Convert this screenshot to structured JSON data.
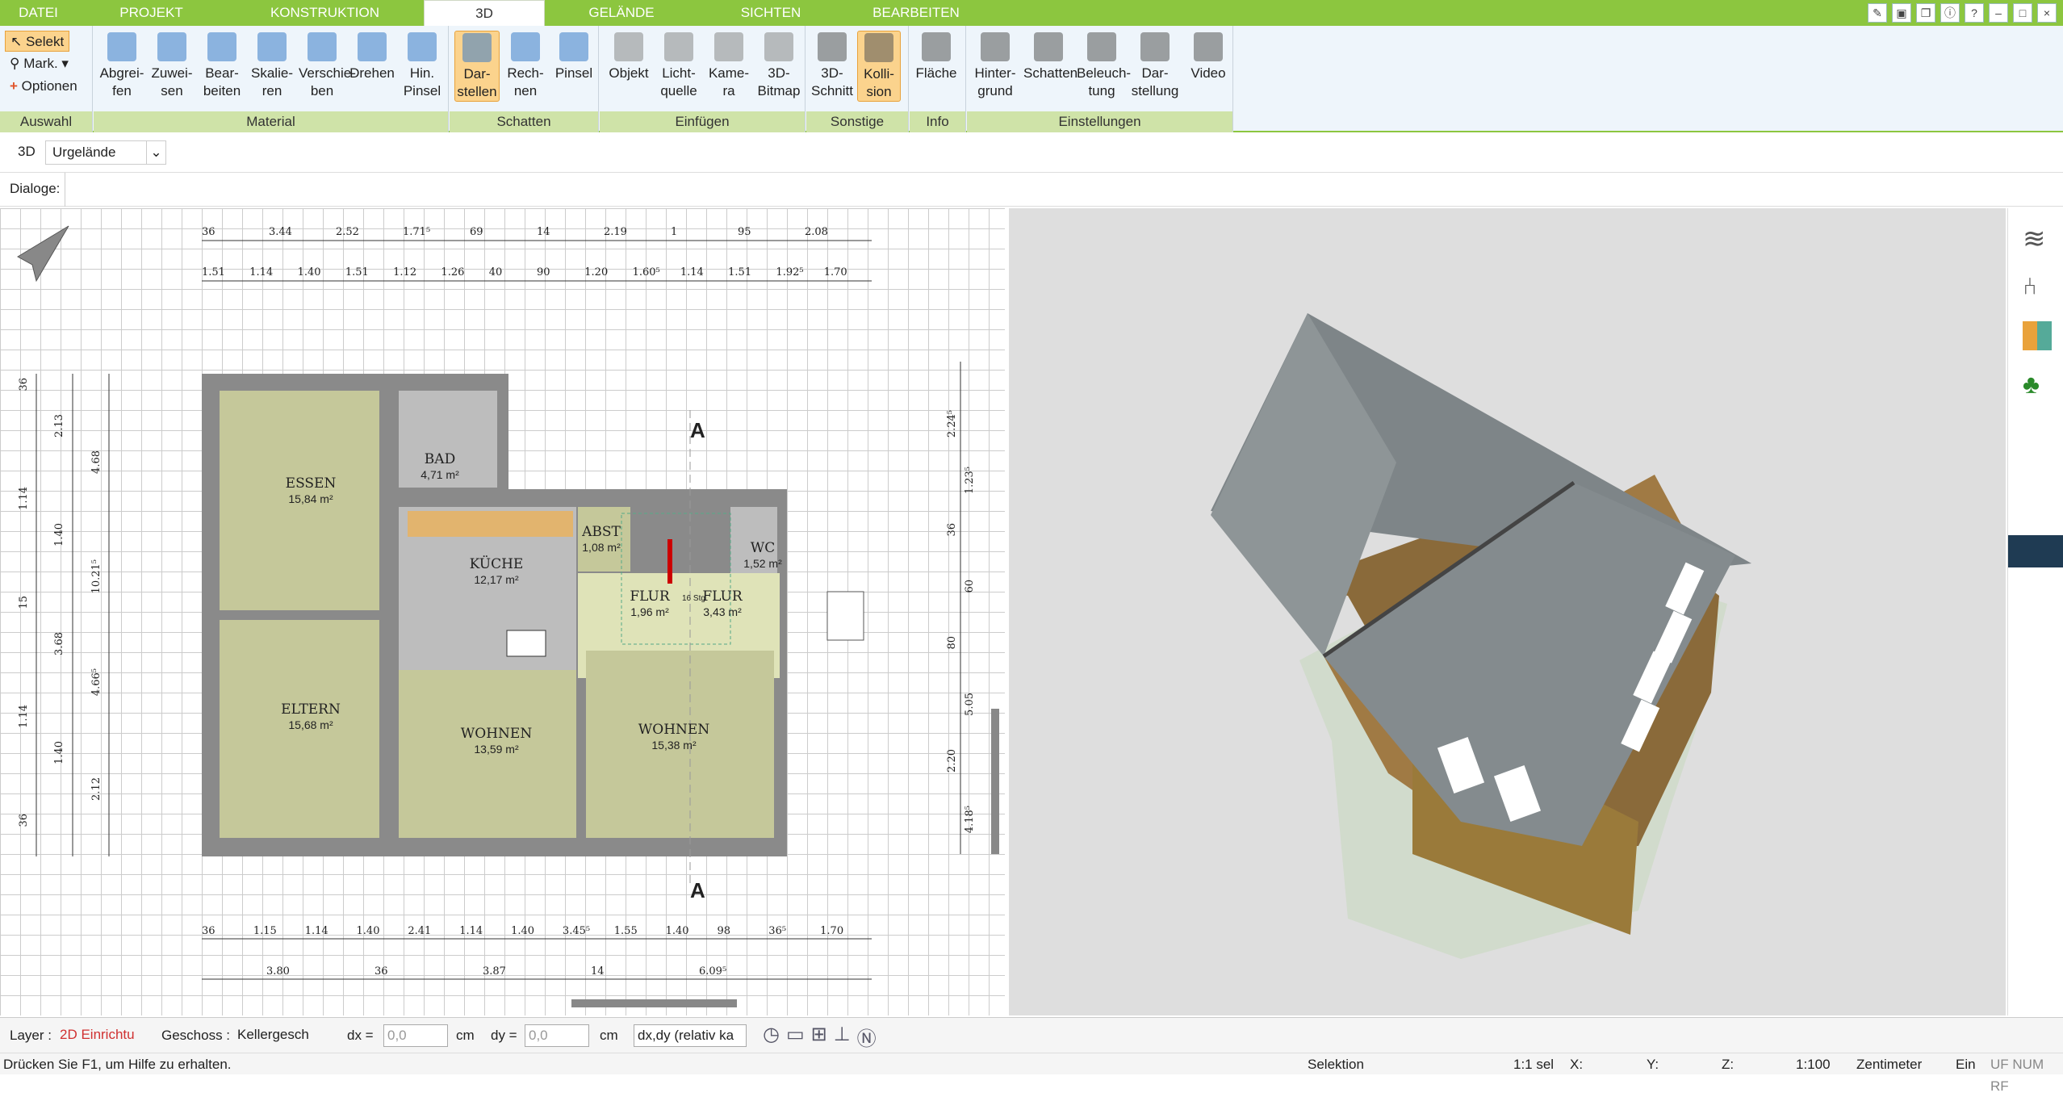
{
  "menu": {
    "tabs": [
      "DATEI",
      "PROJEKT",
      "KONSTRUKTION",
      "3D",
      "GELÄNDE",
      "SICHTEN",
      "BEARBEITEN"
    ]
  },
  "ribbon": {
    "auswahl": {
      "label": "Auswahl",
      "selekt": "Selekt",
      "mark": "Mark.",
      "optionen": "Optionen"
    },
    "material": {
      "label": "Material",
      "buttons": [
        "Abgrei-\nfen",
        "Zuwei-\nsen",
        "Bear-\nbeiten",
        "Skalie-\nren",
        "Verschie-\nben",
        "Drehen",
        "Hin.\nPinsel"
      ]
    },
    "schatten": {
      "label": "Schatten",
      "buttons": [
        "Dar-\nstellen",
        "Rech-\nnen",
        "Pinsel"
      ]
    },
    "einfuegen": {
      "label": "Einfügen",
      "buttons": [
        "Objekt",
        "Licht-\nquelle",
        "Kame-\nra",
        "3D-\nBitmap"
      ]
    },
    "sonstige": {
      "label": "Sonstige",
      "buttons": [
        "3D-\nSchnitt",
        "Kolli-\nsion"
      ]
    },
    "info": {
      "label": "Info",
      "buttons": [
        "Fläche"
      ]
    },
    "einstellungen": {
      "label": "Einstellungen",
      "buttons": [
        "Hinter-\ngrund",
        "Schatten",
        "Beleuch-\ntung",
        "Dar-\nstellung",
        "Video"
      ]
    }
  },
  "toolbar2": {
    "mode": "3D",
    "dropdown": "Urgelände"
  },
  "dialog": {
    "label": "Dialoge:"
  },
  "plan": {
    "rooms": [
      {
        "name": "ESSEN",
        "area": "15,84 m²"
      },
      {
        "name": "BAD",
        "area": "4,71 m²"
      },
      {
        "name": "KÜCHE",
        "area": "12,17 m²"
      },
      {
        "name": "ABST",
        "area": "1,08 m²"
      },
      {
        "name": "WC",
        "area": "1,52 m²"
      },
      {
        "name": "FLUR",
        "area": "1,96 m²"
      },
      {
        "name": "FLUR",
        "area": "3,43 m²"
      },
      {
        "name": "ELTERN",
        "area": "15,68 m²"
      },
      {
        "name": "WOHNEN",
        "area": "13,59 m²"
      },
      {
        "name": "WOHNEN",
        "area": "15,38 m²"
      }
    ],
    "dims_top1": [
      "36",
      "3.44",
      "2.52",
      "1.71⁵",
      "69",
      "14",
      "2.19",
      "1",
      "95",
      "2.08"
    ],
    "dims_top2": [
      "1.51",
      "1.14",
      "1.40",
      "1.51",
      "1.12",
      "1.26",
      "40",
      "90",
      "1.20",
      "1.60⁵",
      "1.14",
      "1.51",
      "1.92⁵",
      "1.70"
    ],
    "dims_bottom1": [
      "36",
      "1.15",
      "1.14",
      "1.40",
      "2.41",
      "1.14",
      "1.40",
      "3.45⁵",
      "1.55",
      "1.40",
      "98",
      "36⁵",
      "1.70"
    ],
    "dims_bottom2": [
      "3.80",
      "36",
      "3.87",
      "14",
      "6.09⁵"
    ],
    "dims_left": [
      "36",
      "2.13",
      "4.68",
      "1.14",
      "1.40",
      "10.21⁵",
      "15",
      "3.68",
      "4.66⁵",
      "1.14",
      "1.40",
      "2.12",
      "36"
    ],
    "dims_right": [
      "2.24⁵",
      "1.23⁵",
      "36",
      "60",
      "80",
      "5.05",
      "2.20",
      "4.18⁵"
    ],
    "section": "A",
    "stair": "16 Stg"
  },
  "status": {
    "layer_label": "Layer :",
    "layer_value": "2D Einrichtu",
    "geschoss_label": "Geschoss :",
    "geschoss_value": "Kellergesch",
    "dx_label": "dx =",
    "dx_value": "0,0",
    "dy_label": "dy =",
    "dy_value": "0,0",
    "unit": "cm",
    "mode": "dx,dy (relativ ka"
  },
  "hint": {
    "text": "Drücken Sie F1, um Hilfe zu erhalten.",
    "selektion": "Selektion",
    "scale1": "1:1 sel",
    "x": "X:",
    "y": "Y:",
    "z": "Z:",
    "scale": "1:100",
    "unit": "Zentimeter",
    "ein": "Ein",
    "flags": "UF NUM RF"
  },
  "colors": {
    "menu": "#8cc63f",
    "room": "#c5c89a",
    "wall": "#8a8a8a",
    "tile": "#bdbdbd"
  }
}
